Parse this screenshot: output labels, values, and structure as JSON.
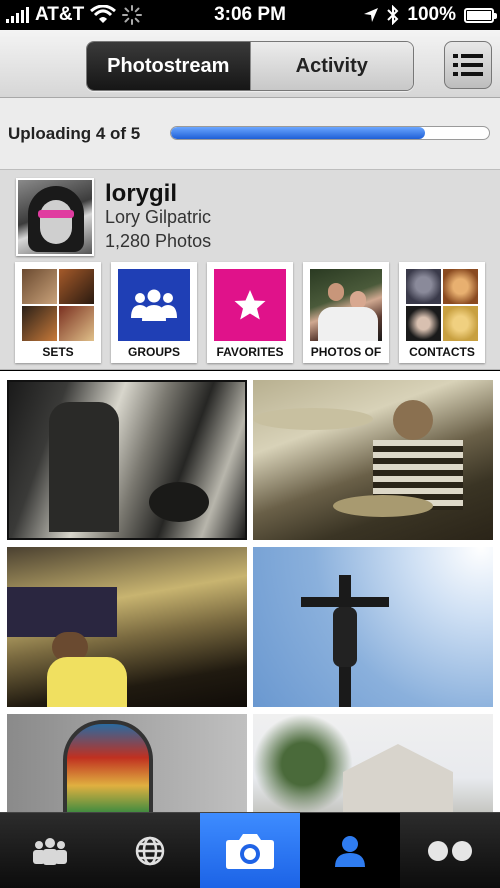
{
  "status_bar": {
    "carrier": "AT&T",
    "time": "3:06 PM",
    "battery": "100%"
  },
  "header": {
    "tabs": [
      {
        "label": "Photostream",
        "selected": true
      },
      {
        "label": "Activity",
        "selected": false
      }
    ],
    "menu_icon": "list-icon"
  },
  "upload": {
    "label": "Uploading 4 of 5",
    "progress": 0.8
  },
  "profile": {
    "username": "lorygil",
    "full_name": "Lory Gilpatric",
    "photo_count": "1,280 Photos"
  },
  "shortcuts": [
    {
      "label": "SETS",
      "icon": "photo-collage"
    },
    {
      "label": "GROUPS",
      "icon": "group-icon",
      "color": "#1f3fb5"
    },
    {
      "label": "FAVORITES",
      "icon": "star-icon",
      "color": "#e0128a"
    },
    {
      "label": "PHOTOS OF",
      "icon": "photo-thumbnail"
    },
    {
      "label": "CONTACTS",
      "icon": "avatar-collage"
    }
  ],
  "tab_bar": [
    {
      "icon": "contacts-icon",
      "selected": false
    },
    {
      "icon": "globe-icon",
      "selected": false
    },
    {
      "icon": "camera-icon",
      "selected": true
    },
    {
      "icon": "profile-icon",
      "selected": true
    },
    {
      "icon": "flickr-dots-icon",
      "selected": false
    }
  ],
  "colors": {
    "accent_blue": "#1f63e6",
    "favorites_pink": "#e0128a",
    "groups_blue": "#1f3fb5"
  }
}
